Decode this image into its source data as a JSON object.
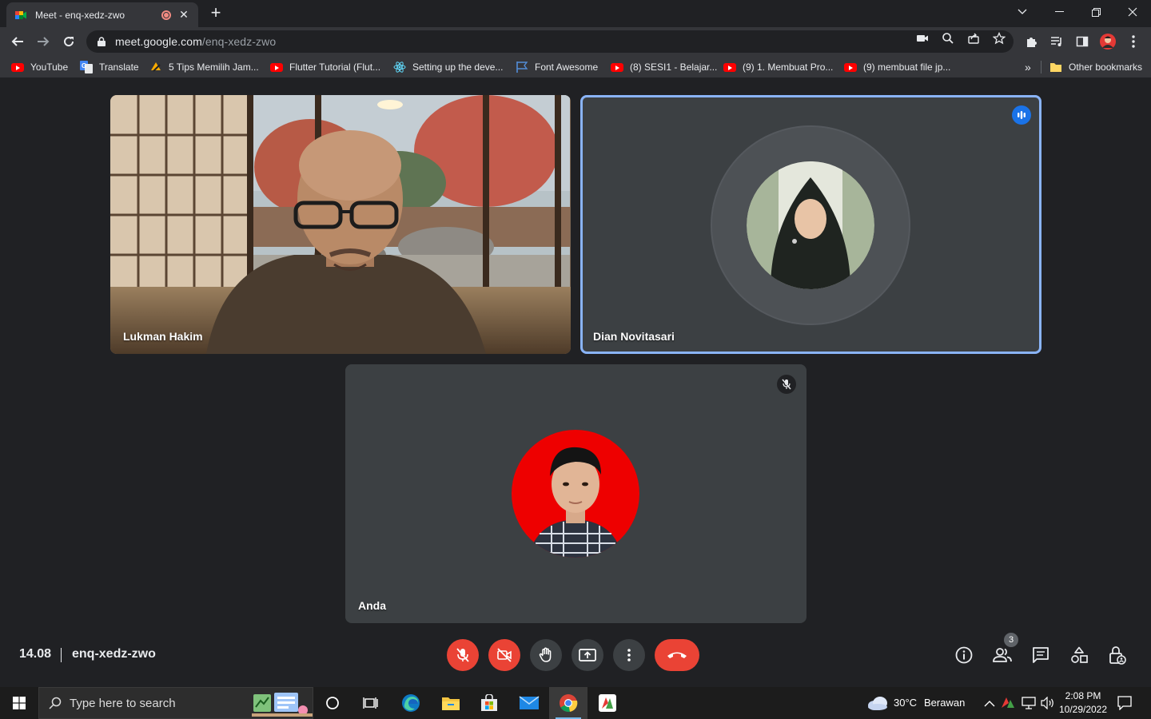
{
  "browser": {
    "tab_title": "Meet - enq-xedz-zwo",
    "url_host": "meet.google.com",
    "url_path": "/enq-xedz-zwo",
    "bookmarks": [
      {
        "label": "YouTube",
        "icon": "youtube-icon"
      },
      {
        "label": "Translate",
        "icon": "google-translate-icon"
      },
      {
        "label": "5 Tips Memilih Jam...",
        "icon": "bookmark-site-icon"
      },
      {
        "label": "Flutter Tutorial (Flut...",
        "icon": "youtube-icon"
      },
      {
        "label": "Setting up the deve...",
        "icon": "react-icon"
      },
      {
        "label": "Font Awesome",
        "icon": "flag-icon"
      },
      {
        "label": "(8) SESI1 - Belajar...",
        "icon": "youtube-icon"
      },
      {
        "label": "(9) 1. Membuat Pro...",
        "icon": "youtube-icon"
      },
      {
        "label": "(9) membuat file jp...",
        "icon": "youtube-icon"
      }
    ],
    "other_bookmarks": "Other bookmarks",
    "more_bookmarks": "»"
  },
  "meet": {
    "participants": [
      {
        "name": "Lukman Hakim",
        "video": true
      },
      {
        "name": "Dian Novitasari",
        "video": false,
        "speaking": true
      },
      {
        "name": "Anda",
        "video": false,
        "muted": true
      }
    ],
    "time": "14.08",
    "meeting_code": "enq-xedz-zwo",
    "people_count": "3",
    "accent": "#8ab4f8",
    "danger": "#ea4335"
  },
  "taskbar": {
    "search_placeholder": "Type here to search",
    "weather_temp": "30°C",
    "weather_desc": "Berawan",
    "time": "2:08 PM",
    "date": "10/29/2022"
  }
}
